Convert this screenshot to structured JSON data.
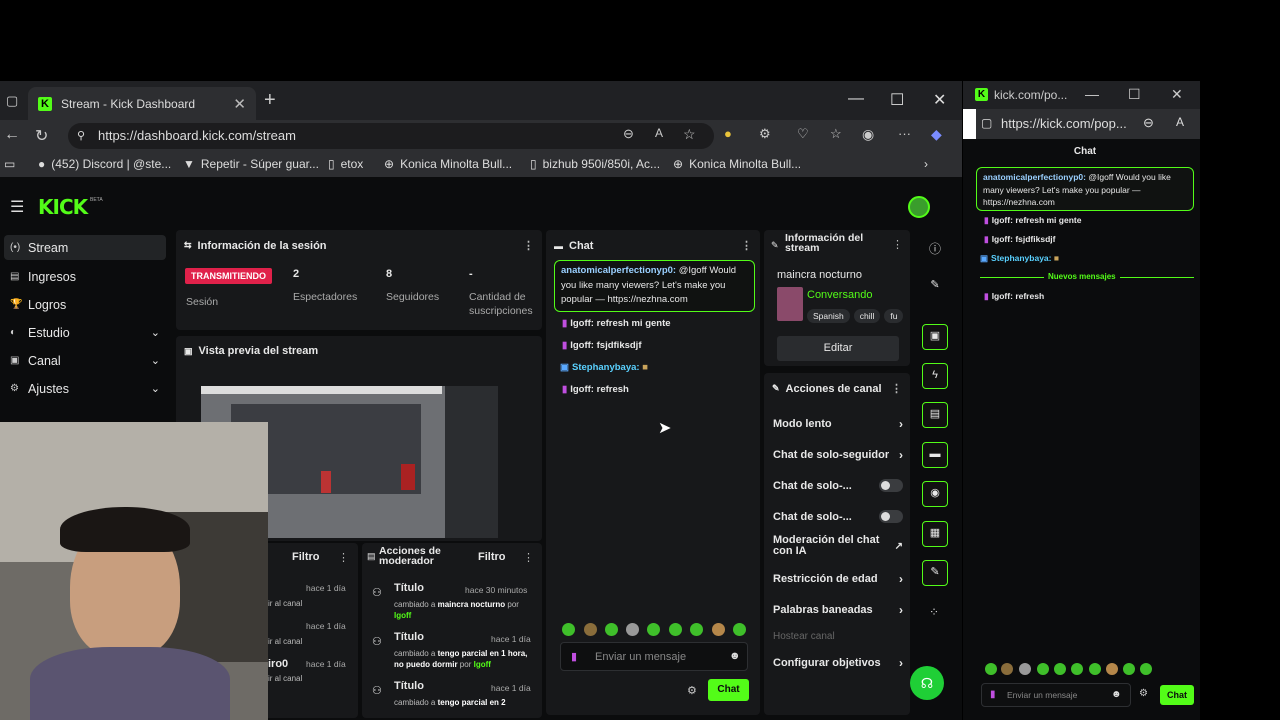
{
  "browser": {
    "tab_title": "Stream - Kick Dashboard",
    "url": "https://dashboard.kick.com/stream",
    "bookmarks": [
      "(452) Discord | @ste...",
      "Repetir - Súper guar...",
      "etox",
      "Konica Minolta Bull...",
      "bizhub 950i/850i, Ac...",
      "Konica Minolta Bull..."
    ]
  },
  "app": {
    "logo": "KICK",
    "beta": "BETA",
    "sidebar": [
      {
        "icon": "(•)",
        "label": "Stream",
        "active": true
      },
      {
        "icon": "▤",
        "label": "Ingresos"
      },
      {
        "icon": "🏆",
        "label": "Logros"
      },
      {
        "icon": "◐",
        "label": "Estudio",
        "chevron": "⌄"
      },
      {
        "icon": "▣",
        "label": "Canal",
        "chevron": "⌄"
      },
      {
        "icon": "⚙",
        "label": "Ajustes",
        "chevron": "⌄"
      }
    ],
    "session": {
      "title": "Información de la sesión",
      "live_badge": "TRANSMITIENDO",
      "session_label": "Sesión",
      "viewers_value": "2",
      "viewers_label": "Espectadores",
      "followers_value": "8",
      "followers_label": "Seguidores",
      "subs_value": "-",
      "subs_label": "Cantidad de suscripciones"
    },
    "preview": {
      "title": "Vista previa del stream"
    },
    "activity": {
      "filter": "Filtro",
      "rows": [
        "hace 1 día",
        "ir al canal",
        "hace 1 día",
        "ir al canal",
        "iro0",
        "hace 1 día",
        "ir al canal"
      ]
    },
    "mod_actions": {
      "title": "Acciones de moderador",
      "filter": "Filtro",
      "rows": [
        {
          "title": "Título",
          "time": "hace 30 minutos",
          "desc_pre": "cambiado a",
          "desc_value": "maincra nocturno",
          "desc_by": "por",
          "user": "Igoff"
        },
        {
          "title": "Título",
          "time": "hace 1 día",
          "desc_pre": "cambiado a",
          "desc_value": "tengo parcial en 1 hora, no puedo dormir",
          "desc_by": "por",
          "user": "Igoff"
        },
        {
          "title": "Título",
          "time": "hace 1 día",
          "desc_pre": "cambiado a",
          "desc_value": "tengo parcial en 2",
          "desc_by": "",
          "user": ""
        }
      ]
    },
    "chat": {
      "title": "Chat",
      "highlight_user": "anatomicalperfectionyp0:",
      "highlight_text": "@Igoff Would you like many viewers? Let's make you popular — https://nezhna.com",
      "messages": [
        {
          "user": "Igoff:",
          "text": "refresh mi gente"
        },
        {
          "user": "Igoff:",
          "text": "fsjdfiksdjf"
        },
        {
          "user": "Stephanybaya:",
          "text": ""
        },
        {
          "user": "Igoff:",
          "text": "refresh"
        }
      ],
      "input_placeholder": "Enviar un mensaje",
      "send": "Chat"
    },
    "stream_info": {
      "title": "Información del stream",
      "stream_title": "maincra nocturno",
      "category": "Conversando",
      "tags": [
        "Spanish",
        "chill",
        "fu"
      ],
      "edit": "Editar"
    },
    "channel_actions": {
      "title": "Acciones de canal",
      "items": [
        {
          "label": "Modo lento",
          "kind": "chevron"
        },
        {
          "label": "Chat de solo-seguidor",
          "kind": "chevron"
        },
        {
          "label": "Chat de solo-...",
          "kind": "toggle"
        },
        {
          "label": "Chat de solo-...",
          "kind": "toggle"
        },
        {
          "label": "Moderación del chat con IA",
          "kind": "external"
        },
        {
          "label": "Restricción de edad",
          "kind": "chevron"
        },
        {
          "label": "Palabras baneadas",
          "kind": "chevron"
        },
        {
          "label": "Hostear canal",
          "kind": "disabled"
        },
        {
          "label": "Configurar objetivos",
          "kind": "chevron"
        }
      ]
    }
  },
  "popout": {
    "title": "kick.com/po...",
    "url": "https://kick.com/pop...",
    "chat_title": "Chat",
    "highlight_user": "anatomicalperfectionyp0:",
    "highlight_text": "@Igoff Would you like many viewers? Let's make you popular — https://nezhna.com",
    "messages": [
      {
        "user": "Igoff:",
        "text": "refresh mi gente"
      },
      {
        "user": "Igoff:",
        "text": "fsjdfiksdjf"
      },
      {
        "user": "Stephanybaya:",
        "text": ""
      }
    ],
    "new_messages": "Nuevos mensajes",
    "after": {
      "user": "Igoff:",
      "text": "refresh"
    },
    "input_placeholder": "Enviar un mensaje",
    "send": "Chat"
  },
  "colors": {
    "accent": "#53fc18",
    "live": "#e0214a",
    "panel": "#17181a",
    "bg": "#0b0c0d"
  }
}
